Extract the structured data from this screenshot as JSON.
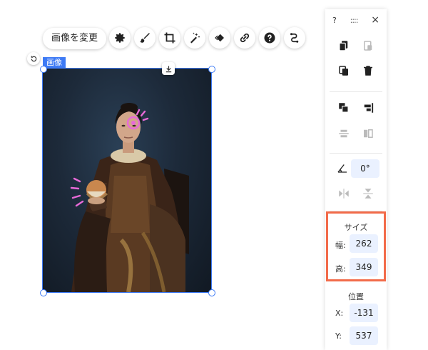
{
  "toolbar": {
    "change_image_label": "画像を変更",
    "tools": [
      {
        "icon": "gear-icon"
      },
      {
        "icon": "brush-icon"
      },
      {
        "icon": "crop-icon"
      },
      {
        "icon": "magic-wand-icon"
      },
      {
        "icon": "animation-diamond-icon"
      },
      {
        "icon": "link-icon"
      },
      {
        "icon": "help-icon"
      },
      {
        "icon": "connect-icon"
      }
    ]
  },
  "selection": {
    "label": "画像"
  },
  "panel": {
    "help_label": "?",
    "drag_label": "::::",
    "close_label": "×",
    "rotation_value": "0°",
    "size": {
      "title": "サイズ",
      "width_label": "幅:",
      "width_value": "262",
      "height_label": "高:",
      "height_value": "349"
    },
    "position": {
      "title": "位置",
      "x_label": "X:",
      "x_value": "-131",
      "y_label": "Y:",
      "y_value": "537"
    }
  },
  "colors": {
    "accent": "#3d7af5",
    "highlight": "#f26b4a",
    "field_bg": "#eaf1ff"
  }
}
